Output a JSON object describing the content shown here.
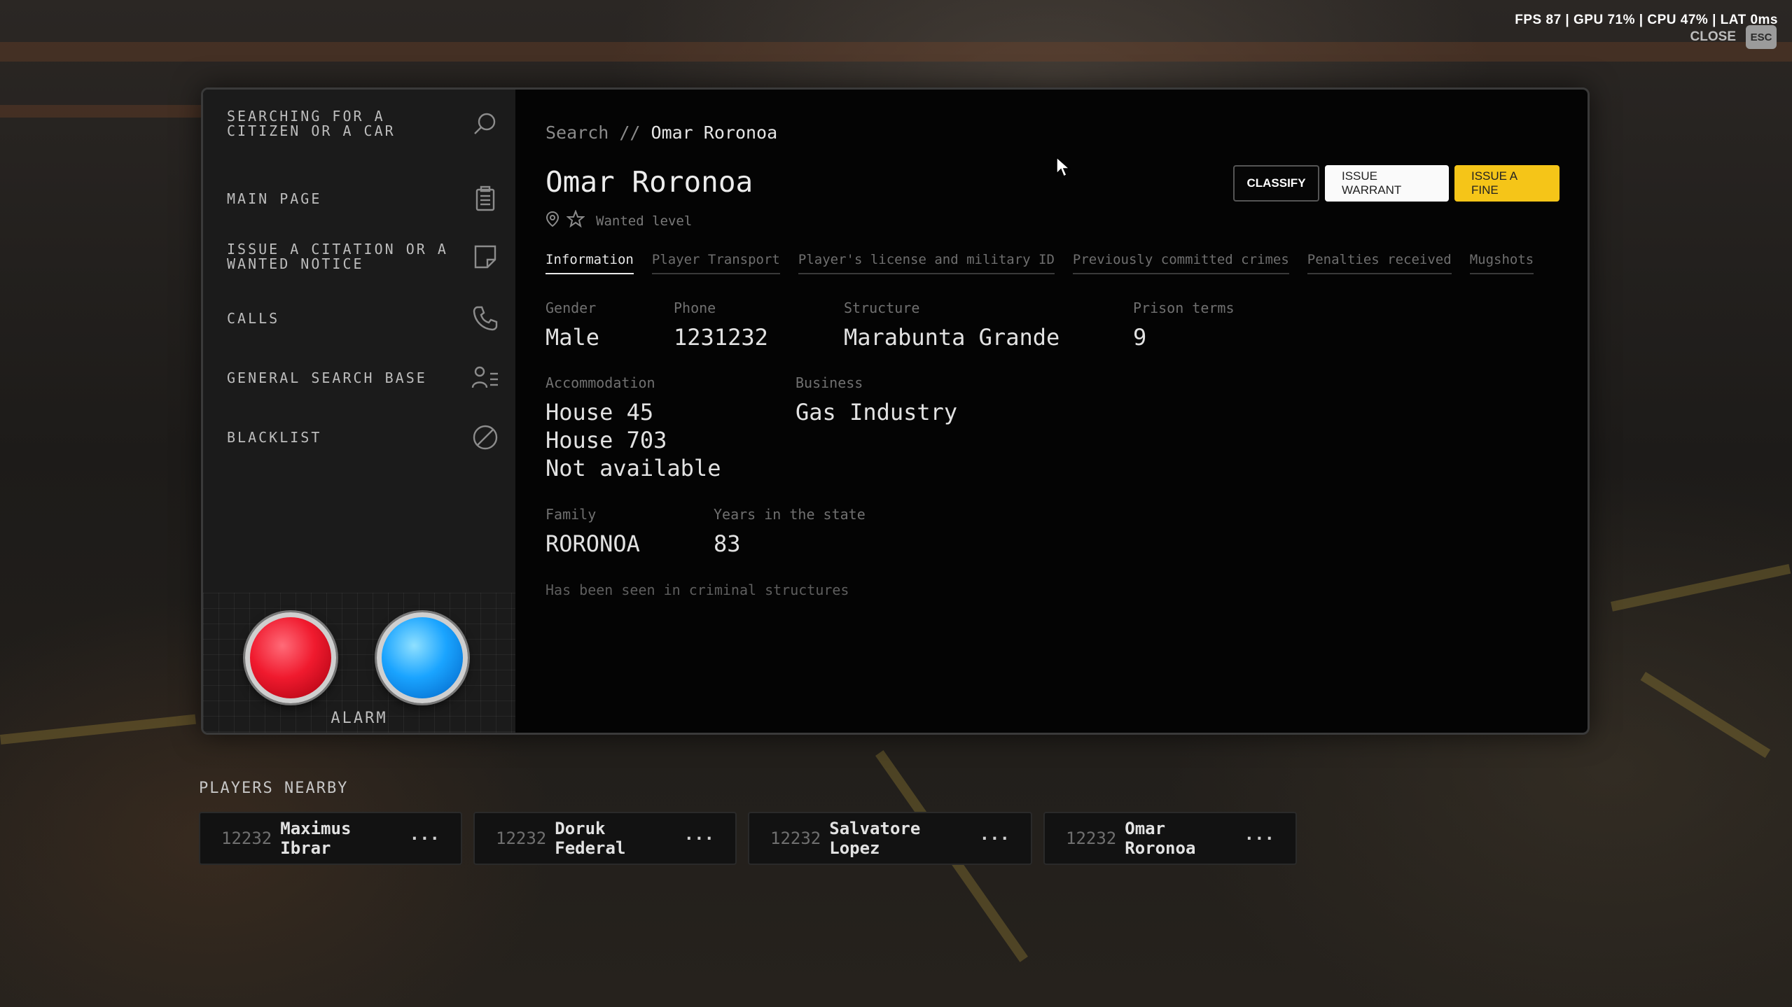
{
  "hud": {
    "stats": "FPS 87 | GPU 71% | CPU 47% | LAT 0ms",
    "close_label": "CLOSE",
    "esc_key": "ESC"
  },
  "sidebar": {
    "items": [
      {
        "label": "SEARCHING FOR A CITIZEN OR A CAR",
        "icon": "search-icon"
      },
      {
        "label": "MAIN PAGE",
        "icon": "clipboard-icon"
      },
      {
        "label": "ISSUE A CITATION OR A WANTED NOTICE",
        "icon": "note-icon"
      },
      {
        "label": "CALLS",
        "icon": "phone-icon"
      },
      {
        "label": "GENERAL SEARCH BASE",
        "icon": "user-list-icon"
      },
      {
        "label": "BLACKLIST",
        "icon": "ban-icon"
      }
    ],
    "alarm_label": "ALARM"
  },
  "main": {
    "breadcrumb": {
      "prefix": "Search //",
      "current": "Omar Roronoa"
    },
    "title": "Omar Roronoa",
    "wanted_label": "Wanted level",
    "buttons": {
      "classify": "CLASSIFY",
      "warrant": "ISSUE WARRANT",
      "fine": "ISSUE A FINE"
    },
    "tabs": [
      "Information",
      "Player Transport",
      "Player's license and military ID",
      "Previously committed crimes",
      "Penalties received",
      "Mugshots"
    ],
    "info": {
      "gender": {
        "label": "Gender",
        "value": "Male"
      },
      "phone": {
        "label": "Phone",
        "value": "1231232"
      },
      "structure": {
        "label": "Structure",
        "value": "Marabunta Grande"
      },
      "prison_terms": {
        "label": "Prison terms",
        "value": "9"
      },
      "accommodation": {
        "label": "Accommodation",
        "values": [
          "House 45",
          "House 703",
          "Not available"
        ]
      },
      "business": {
        "label": "Business",
        "value": "Gas Industry"
      },
      "family": {
        "label": "Family",
        "value": "RORONOA"
      },
      "years": {
        "label": "Years in the state",
        "value": "83"
      }
    },
    "note": "Has been seen in criminal structures"
  },
  "nearby": {
    "title": "PLAYERS NEARBY",
    "players": [
      {
        "id": "12232",
        "name": "Maximus Ibrar"
      },
      {
        "id": "12232",
        "name": "Doruk Federal"
      },
      {
        "id": "12232",
        "name": "Salvatore Lopez"
      },
      {
        "id": "12232",
        "name": "Omar Roronoa"
      }
    ],
    "more_glyph": "···"
  }
}
